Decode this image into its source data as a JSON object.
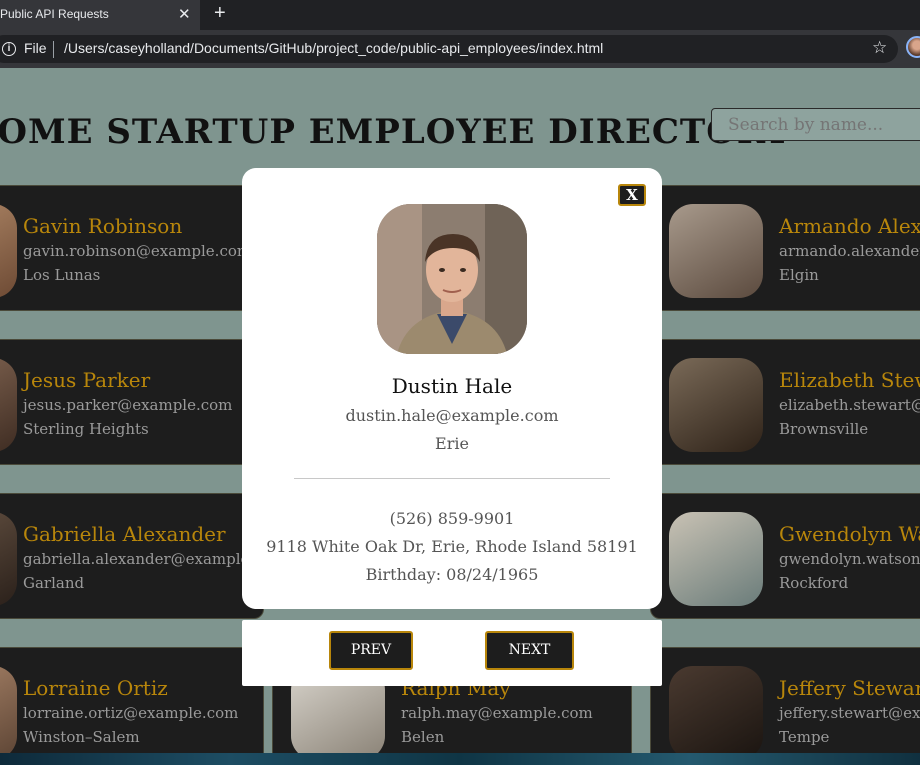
{
  "browser": {
    "tab_title": "Public API Requests",
    "tab_close": "✕",
    "new_tab": "+",
    "scheme_label": "File",
    "url": "/Users/caseyholland/Documents/GitHub/project_code/public-api_employees/index.html"
  },
  "header": {
    "title": "AWESOME STARTUP EMPLOYEE DIRECTORY",
    "search_placeholder": "Search by name..."
  },
  "employees": [
    {
      "name": "Gavin Robinson",
      "email": "gavin.robinson@example.com",
      "city": "Los Lunas"
    },
    {
      "name": "Armando Alexander",
      "email": "armando.alexander@example.com",
      "city": "Elgin"
    },
    {
      "name": "Jesus Parker",
      "email": "jesus.parker@example.com",
      "city": "Sterling Heights"
    },
    {
      "name": "Elizabeth Stewart",
      "email": "elizabeth.stewart@example.com",
      "city": "Brownsville"
    },
    {
      "name": "Gabriella Alexander",
      "email": "gabriella.alexander@example.com",
      "city": "Garland"
    },
    {
      "name": "Gwendolyn Watson",
      "email": "gwendolyn.watson@example.com",
      "city": "Rockford"
    },
    {
      "name": "Lorraine Ortiz",
      "email": "lorraine.ortiz@example.com",
      "city": "Winston–Salem"
    },
    {
      "name": "Ralph May",
      "email": "ralph.may@example.com",
      "city": "Belen"
    },
    {
      "name": "Jeffery Stewart",
      "email": "jeffery.stewart@example.com",
      "city": "Tempe"
    }
  ],
  "modal": {
    "close_label": "X",
    "name": "Dustin Hale",
    "email": "dustin.hale@example.com",
    "city": "Erie",
    "phone": "(526) 859-9901",
    "address": "9118 White Oak Dr, Erie, Rhode Island 58191",
    "birthday": "Birthday: 08/24/1965",
    "prev_label": "PREV",
    "next_label": "NEXT"
  },
  "colors": {
    "accent": "#b8860b",
    "card_bg": "#1d1d1d",
    "page_bg": "#7f958f"
  }
}
